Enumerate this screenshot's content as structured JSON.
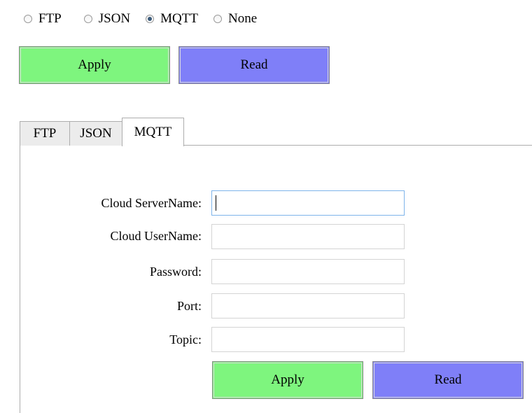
{
  "protocol_selector": {
    "options": [
      {
        "label": "FTP",
        "checked": false
      },
      {
        "label": "JSON",
        "checked": false
      },
      {
        "label": "MQTT",
        "checked": true
      },
      {
        "label": "None",
        "checked": false
      }
    ]
  },
  "top_buttons": {
    "apply_label": "Apply",
    "read_label": "Read"
  },
  "tabs": [
    {
      "label": "FTP",
      "active": false
    },
    {
      "label": "JSON",
      "active": false
    },
    {
      "label": "MQTT",
      "active": true
    }
  ],
  "mqtt_form": {
    "fields": [
      {
        "label": "Cloud ServerName:",
        "value": ""
      },
      {
        "label": "Cloud UserName:",
        "value": ""
      },
      {
        "label": "Password:",
        "value": ""
      },
      {
        "label": "Port:",
        "value": ""
      },
      {
        "label": "Topic:",
        "value": ""
      }
    ],
    "apply_label": "Apply",
    "read_label": "Read"
  },
  "colors": {
    "apply_button": "#7ef57e",
    "read_button": "#7f7ff8",
    "focus_border": "#7eb4ea"
  }
}
